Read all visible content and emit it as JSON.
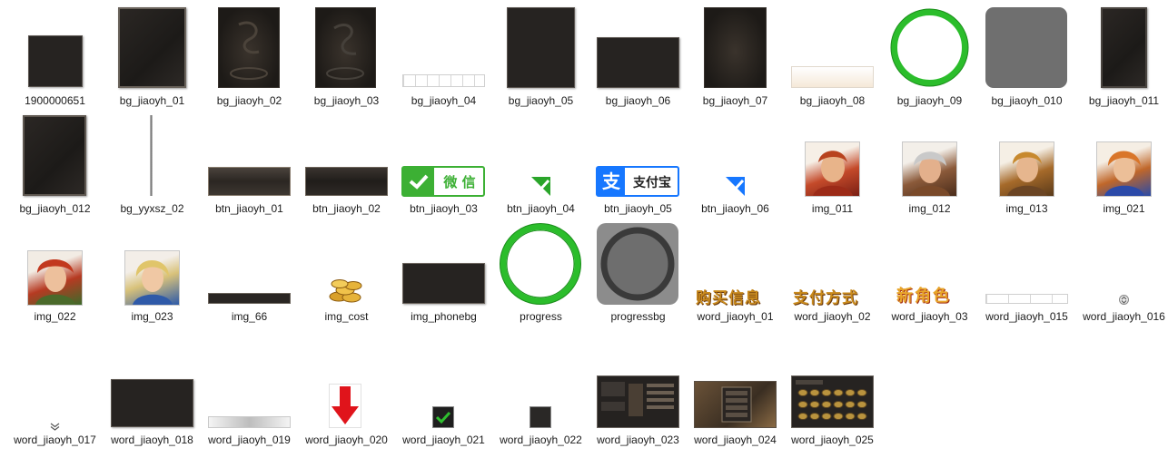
{
  "files": [
    {
      "name": "1900000651"
    },
    {
      "name": "bg_jiaoyh_01"
    },
    {
      "name": "bg_jiaoyh_02"
    },
    {
      "name": "bg_jiaoyh_03"
    },
    {
      "name": "bg_jiaoyh_04"
    },
    {
      "name": "bg_jiaoyh_05"
    },
    {
      "name": "bg_jiaoyh_06"
    },
    {
      "name": "bg_jiaoyh_07"
    },
    {
      "name": "bg_jiaoyh_08"
    },
    {
      "name": "bg_jiaoyh_09"
    },
    {
      "name": "bg_jiaoyh_010"
    },
    {
      "name": "bg_jiaoyh_011"
    },
    {
      "name": "bg_jiaoyh_012"
    },
    {
      "name": "bg_yyxsz_02"
    },
    {
      "name": "btn_jiaoyh_01"
    },
    {
      "name": "btn_jiaoyh_02"
    },
    {
      "name": "btn_jiaoyh_03",
      "text": "微 信"
    },
    {
      "name": "btn_jiaoyh_04"
    },
    {
      "name": "btn_jiaoyh_05",
      "text": "支付宝",
      "glyph": "支"
    },
    {
      "name": "btn_jiaoyh_06"
    },
    {
      "name": "img_011"
    },
    {
      "name": "img_012"
    },
    {
      "name": "img_013"
    },
    {
      "name": "img_021"
    },
    {
      "name": "img_022"
    },
    {
      "name": "img_023"
    },
    {
      "name": "img_66"
    },
    {
      "name": "img_cost"
    },
    {
      "name": "img_phonebg"
    },
    {
      "name": "progress"
    },
    {
      "name": "progressbg"
    },
    {
      "name": "word_jiaoyh_01",
      "text": "购买信息"
    },
    {
      "name": "word_jiaoyh_02",
      "text": "支付方式"
    },
    {
      "name": "word_jiaoyh_03",
      "text": "新角色"
    },
    {
      "name": "word_jiaoyh_015"
    },
    {
      "name": "word_jiaoyh_016"
    },
    {
      "name": "word_jiaoyh_017"
    },
    {
      "name": "word_jiaoyh_018"
    },
    {
      "name": "word_jiaoyh_019"
    },
    {
      "name": "word_jiaoyh_020"
    },
    {
      "name": "word_jiaoyh_021"
    },
    {
      "name": "word_jiaoyh_022"
    },
    {
      "name": "word_jiaoyh_023"
    },
    {
      "name": "word_jiaoyh_024"
    },
    {
      "name": "word_jiaoyh_025"
    }
  ],
  "colors": {
    "wechat_green": "#3cb034",
    "alipay_blue": "#1677ff",
    "ring_green": "#2bbd2b",
    "arrow_red": "#e0141b",
    "gold": "#d9a02a",
    "word_gold": "#c98a1c",
    "word_red": "#a3301a"
  }
}
